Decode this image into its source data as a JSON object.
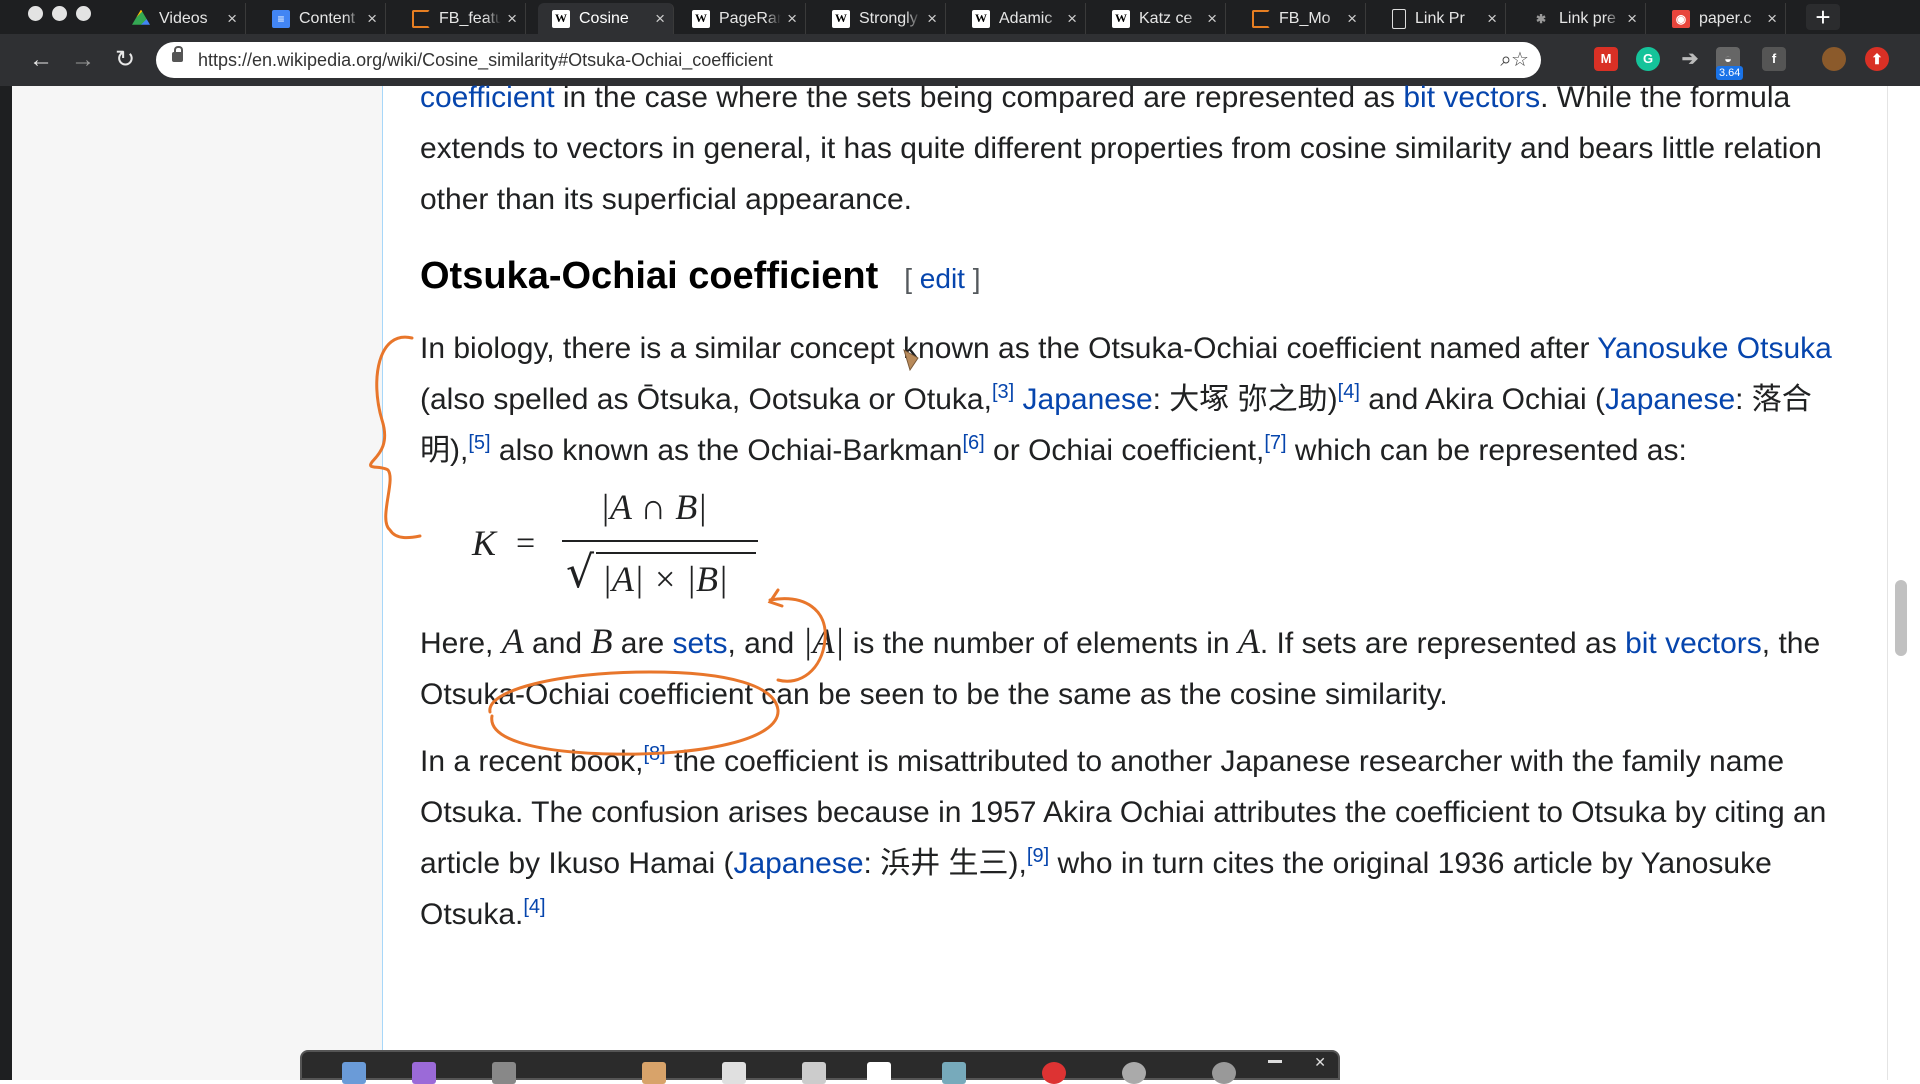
{
  "browser": {
    "tabs": [
      {
        "title": "Videos",
        "icon": "google-drive-icon",
        "active": false
      },
      {
        "title": "Content",
        "icon": "google-docs-icon",
        "active": false
      },
      {
        "title": "FB_features",
        "icon": "loading-ring-icon",
        "active": false
      },
      {
        "title": "Cosine",
        "icon": "wikipedia-icon",
        "active": true
      },
      {
        "title": "PageRank",
        "icon": "wikipedia-icon",
        "active": false
      },
      {
        "title": "Strongly",
        "icon": "wikipedia-icon",
        "active": false
      },
      {
        "title": "Adamic",
        "icon": "wikipedia-icon",
        "active": false
      },
      {
        "title": "Katz ce",
        "icon": "wikipedia-icon",
        "active": false
      },
      {
        "title": "FB_Mo",
        "icon": "loading-ring-icon",
        "active": false
      },
      {
        "title": "Link Pr",
        "icon": "document-icon",
        "active": false
      },
      {
        "title": "Link pre",
        "icon": "gear-icon",
        "active": false
      },
      {
        "title": "paper.c",
        "icon": "pdf-icon",
        "active": false
      }
    ],
    "url": "https://en.wikipedia.org/wiki/Cosine_similarity#Otsuka-Ochiai_coefficient",
    "extension_badge": "3.64"
  },
  "article": {
    "intro": {
      "link1": "coefficient",
      "t1": " in the case where the sets being compared are represented as ",
      "link2": "bit vectors",
      "t2": ". While the formula extends to vectors in general, it has quite different properties from cosine similarity and bears little relation other than its superficial appearance."
    },
    "heading": "Otsuka-Ochiai coefficient",
    "edit_open": "[ ",
    "edit_label": "edit",
    "edit_close": " ]",
    "p1": {
      "t1": "In biology, there is a similar concept known as the Otsuka-Ochiai coefficient named after ",
      "link1": "Yanosuke Otsuka",
      "t2": " (also spelled as Ōtsuka, Ootsuka or Otuka,",
      "ref1": "[3]",
      "link2": "Japanese",
      "t3": ": 大塚 弥之助)",
      "ref2": "[4]",
      "t4": " and Akira Ochiai (",
      "link3": "Japanese",
      "t5": ": 落合 明),",
      "ref3": "[5]",
      "t6": " also known as the Ochiai-Barkman",
      "ref4": "[6]",
      "t7": " or Ochiai coefficient,",
      "ref5": "[7]",
      "t8": " which can be represented as:"
    },
    "formula": {
      "lhs": "K",
      "equals": "=",
      "numerator": "|A ∩ B|",
      "denominator": "|A| × |B|"
    },
    "p2": {
      "t1": "Here, ",
      "m1": "A",
      "t2": " and ",
      "m2": "B",
      "t3": " are ",
      "link1": "sets",
      "t4": ", and ",
      "m3": "|A|",
      "t5": " is the number of elements in ",
      "m4": "A",
      "t6": ". If sets are represented as ",
      "link2": "bit vectors",
      "t7": ", the Otsuka-Ochiai coefficient can be seen to be the same as the cosine similarity."
    },
    "p3": {
      "t1": "In a recent book,",
      "ref1": "[8]",
      "t2": " the coefficient is misattributed to another Japanese researcher with the family name Otsuka. The confusion arises because in 1957 Akira Ochiai attributes the coefficient to Otsuka by citing an article by Ikuso Hamai (",
      "link1": "Japanese",
      "t3": ": 浜井 生三),",
      "ref2": "[9]",
      "t4": " who in turn cites the original 1936 article by Yanosuke Otsuka.",
      "ref3": "[4]"
    }
  },
  "colors": {
    "link": "#0645ad",
    "annotation": "#e8762b",
    "sidebar": "#f6f6f6",
    "chrome": "#1e1f21"
  }
}
